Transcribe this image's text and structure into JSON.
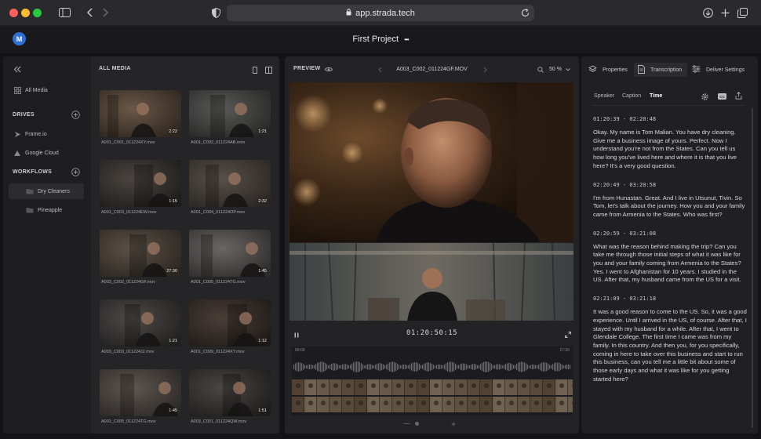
{
  "browser": {
    "url": "app.strada.tech"
  },
  "app": {
    "avatar_initial": "M",
    "project_title": "First Project",
    "more_glyph": "•••"
  },
  "sidebar": {
    "all_media": "All Media",
    "drives_label": "DRIVES",
    "drives": [
      "Frame.io",
      "Google Cloud"
    ],
    "workflows_label": "WORKFLOWS",
    "workflows": [
      "Dry Cleaners",
      "Pineapple"
    ]
  },
  "media": {
    "header": "ALL MEDIA",
    "items": [
      {
        "name": "A001_C001_011224XY.mov",
        "duration": "2:22"
      },
      {
        "name": "A001_C002_011224AB.mov",
        "duration": "1:21"
      },
      {
        "name": "A001_C003_011224EW.mov",
        "duration": "1:15"
      },
      {
        "name": "A001_C004_011224OP.mov",
        "duration": "2:32"
      },
      {
        "name": "A003_C002_011224GF.mov",
        "duration": "27:30"
      },
      {
        "name": "A001_C005_011224TG.mov",
        "duration": "1:45"
      },
      {
        "name": "A003_C003_011224JJ.mov",
        "duration": "1:21"
      },
      {
        "name": "A001_C009_011224XY.mov",
        "duration": "1:12"
      },
      {
        "name": "A001_C005_011224TG.mov",
        "duration": "1:45"
      },
      {
        "name": "A003_C001_011224QW.mov",
        "duration": "1:51"
      }
    ]
  },
  "preview": {
    "header": "PREVIEW",
    "clip_name": "A003_C002_011224GF.MOV",
    "zoom": "50 %",
    "timecode": "01:20:50:15",
    "timeline_start": "00:00",
    "timeline_end": "27:30"
  },
  "right": {
    "tabs": [
      "Properties",
      "Transcription",
      "Deliver Settings"
    ],
    "subtabs": [
      "Speaker",
      "Caption",
      "Time"
    ],
    "cc_label": "CC",
    "segments": [
      {
        "time": "01:20:39 - 02:20:48",
        "text": "Okay. My name is Tom Malian. You have dry cleaning. Give me a business image of yours. Perfect. Now I understand you're not from the States. Can you tell us how long you've lived here and where it is that you live here? It's a very good question."
      },
      {
        "time": "02:20:49 - 03:20:58",
        "text": "I'm from Hunastan. Great. And I live in Utsunut, Tivin. So Tom, let's talk about the journey. How you and your family came from Armenia to the States. Who was first?"
      },
      {
        "time": "02:20:59 - 03:21:08",
        "text": "What was the reason behind making the trip? Can you take me through those initial steps of what it was like for you and your family coming from Armenia to the States? Yes. I went to Afghanistan for 10 years. I studied in the US. After that, my husband came from the US for a visit."
      },
      {
        "time": "02:21:09 - 03:21:18",
        "text": "It was a good reason to come to the US. So, it was a good experience. Until I arrived in the US, of course. After that, I stayed with my husband for a while. After that, I went to Glendale College. The first time I came was from my family. In this country. And then you, for you specifically, coming in here to take over this business and start to run this business, can you tell me a little bit about some of those early days and what it was like for you getting started here?"
      }
    ]
  }
}
